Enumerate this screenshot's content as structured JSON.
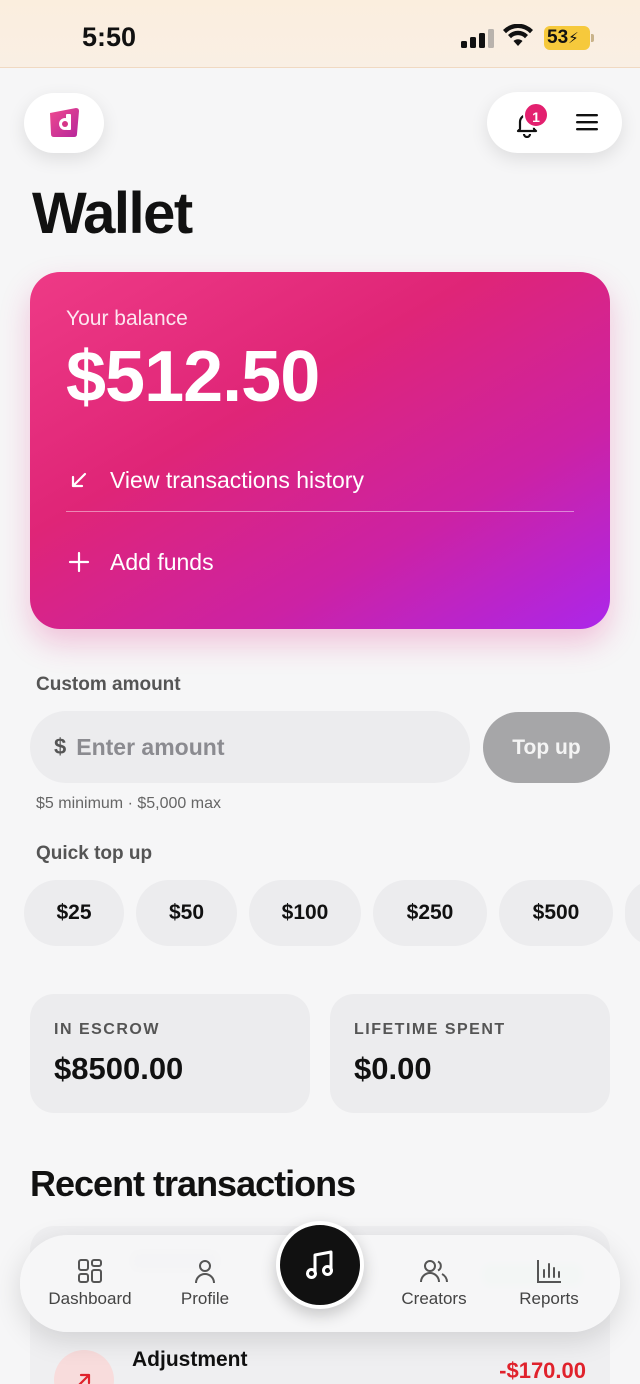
{
  "status_bar": {
    "time": "5:50",
    "battery": "53"
  },
  "header": {
    "notification_count": "1"
  },
  "page": {
    "title": "Wallet"
  },
  "balance_card": {
    "label": "Your balance",
    "amount": "$512.50",
    "history_label": "View transactions history",
    "add_funds_label": "Add funds"
  },
  "custom_amount": {
    "label": "Custom amount",
    "currency_symbol": "$",
    "placeholder": "Enter amount",
    "value": "",
    "button_label": "Top up",
    "limits_note": "$5 minimum · $5,000 max"
  },
  "quick_top_up": {
    "label": "Quick top up",
    "options": [
      "$25",
      "$50",
      "$100",
      "$250",
      "$500"
    ]
  },
  "stats": {
    "escrow_label": "IN ESCROW",
    "escrow_value": "$8500.00",
    "spent_label": "LIFETIME SPENT",
    "spent_value": "$0.00"
  },
  "recent": {
    "title": "Recent transactions",
    "transactions": [
      {
        "name": "Adjustment",
        "amount": "-$170.00"
      }
    ]
  },
  "bottom_nav": {
    "items": [
      {
        "label": "Dashboard",
        "icon": "dashboard-icon"
      },
      {
        "label": "Profile",
        "icon": "profile-icon"
      },
      {
        "label": "Creators",
        "icon": "creators-icon"
      },
      {
        "label": "Reports",
        "icon": "reports-icon"
      }
    ],
    "center_icon": "music-note-icon"
  },
  "colors": {
    "accent": "#e3206f",
    "card_gradient_start": "#ee3a86",
    "card_gradient_end": "#ac26ea",
    "negative": "#e0222c"
  }
}
